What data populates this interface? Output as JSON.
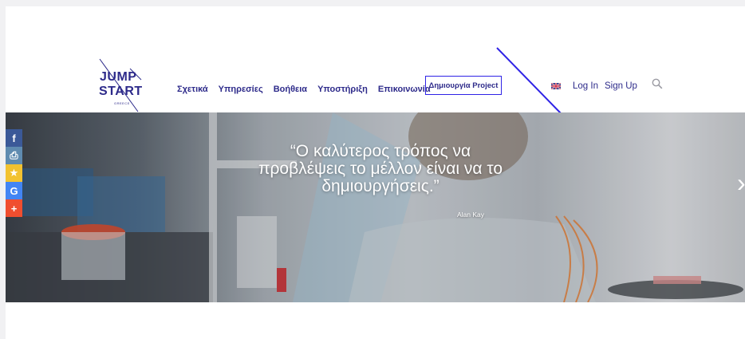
{
  "brand": {
    "logo_line1": "JUMP",
    "logo_line2": "START",
    "logo_sub": "GREECE",
    "color": "#2d2a8a",
    "accent": "#2f23e6"
  },
  "nav": {
    "items": [
      {
        "label": "Σχετικά"
      },
      {
        "label": "Υπηρεσίες"
      },
      {
        "label": "Βοήθεια"
      },
      {
        "label": "Υποστήριξη"
      },
      {
        "label": "Επικοινωνία"
      }
    ],
    "cta_label": "Δημιουργία Project",
    "language_icon": "uk-flag-icon",
    "login_label": "Log In",
    "signup_label": "Sign Up",
    "search_icon": "search-icon"
  },
  "hero": {
    "quote": "“Ο καλύτερος τρόπος να προβλέψεις το μέλλον είναι να το δημιουργήσεις.”",
    "author": "Alan Kay",
    "next_icon": "›"
  },
  "share": {
    "buttons": [
      {
        "icon": "facebook-icon",
        "glyph": "f",
        "color": "#3b5998"
      },
      {
        "icon": "print-icon",
        "glyph": "⎙",
        "color": "#5f8bb0"
      },
      {
        "icon": "favorite-star-icon",
        "glyph": "★",
        "color": "#f2c230"
      },
      {
        "icon": "google-icon",
        "glyph": "G",
        "color": "#4285f4"
      },
      {
        "icon": "more-plus-icon",
        "glyph": "+",
        "color": "#f04e2f"
      }
    ]
  }
}
